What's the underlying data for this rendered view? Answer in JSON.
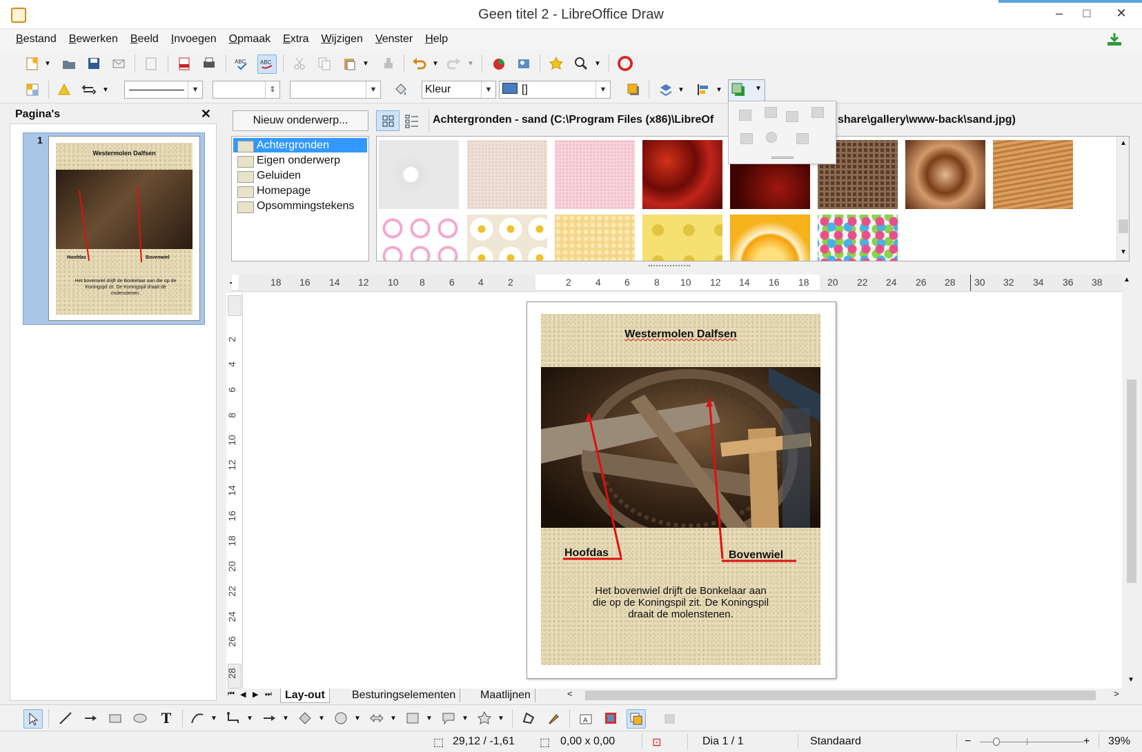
{
  "window": {
    "title": "Geen titel 2 - LibreOffice Draw",
    "minimize": "–",
    "maximize": "□",
    "close": "✕"
  },
  "menu": [
    "Bestand",
    "Bewerken",
    "Beeld",
    "Invoegen",
    "Opmaak",
    "Extra",
    "Wijzigen",
    "Venster",
    "Help"
  ],
  "toolbar2": {
    "fill_style": "Kleur",
    "fill_color": "[]"
  },
  "pages_pane": {
    "title": "Pagina's",
    "close": "✕",
    "slide_number": "1",
    "thumb_title": "Westermolen Dalfsen",
    "thumb_label_left": "Hoofdas",
    "thumb_label_right": "Bovenwiel",
    "thumb_text": "Het bovenwiel drijft de Bonkelaar aan die op de Koningspil zit. De Koningspil draait de molenstenen."
  },
  "gallery": {
    "new_theme_button": "Nieuw onderwerp...",
    "path": "Achtergronden - sand (C:\\Program Files (x86)\\LibreOf",
    "path_tail": "share\\gallery\\www-back\\sand.jpg)",
    "themes": [
      "Achtergronden",
      "Eigen onderwerp",
      "Geluiden",
      "Homepage",
      "Opsommingstekens"
    ],
    "selected_theme": "Achtergronden"
  },
  "ruler": {
    "h_left": [
      "18",
      "16",
      "14",
      "12",
      "10",
      "8",
      "6",
      "4",
      "2"
    ],
    "h_right": [
      "2",
      "4",
      "6",
      "8",
      "10",
      "12",
      "14",
      "16",
      "18",
      "20",
      "22",
      "24",
      "26",
      "28",
      "30",
      "32",
      "34",
      "36",
      "38"
    ],
    "v": [
      "2",
      "4",
      "6",
      "8",
      "10",
      "12",
      "14",
      "16",
      "18",
      "20",
      "22",
      "24",
      "26",
      "28"
    ]
  },
  "slide": {
    "title": "Westermolen Dalfsen",
    "label_left": "Hoofdas",
    "label_right": "Bovenwiel",
    "body_line1": "Het bovenwiel drijft de Bonkelaar aan",
    "body_line2": "die op de Koningspil zit. De Koningspil",
    "body_line3": "draait de molenstenen."
  },
  "tabs": [
    "Lay-out",
    "Besturingselementen",
    "Maatlijnen"
  ],
  "active_tab": "Lay-out",
  "status": {
    "position": "29,12 / -1,61",
    "size": "0,00 x 0,00",
    "slide": "Dia 1 / 1",
    "layout": "Standaard",
    "zoom": "39%"
  },
  "colors": {
    "selection": "#3399ff",
    "arrow": "#e01010",
    "sand": "#e8dcb8"
  }
}
